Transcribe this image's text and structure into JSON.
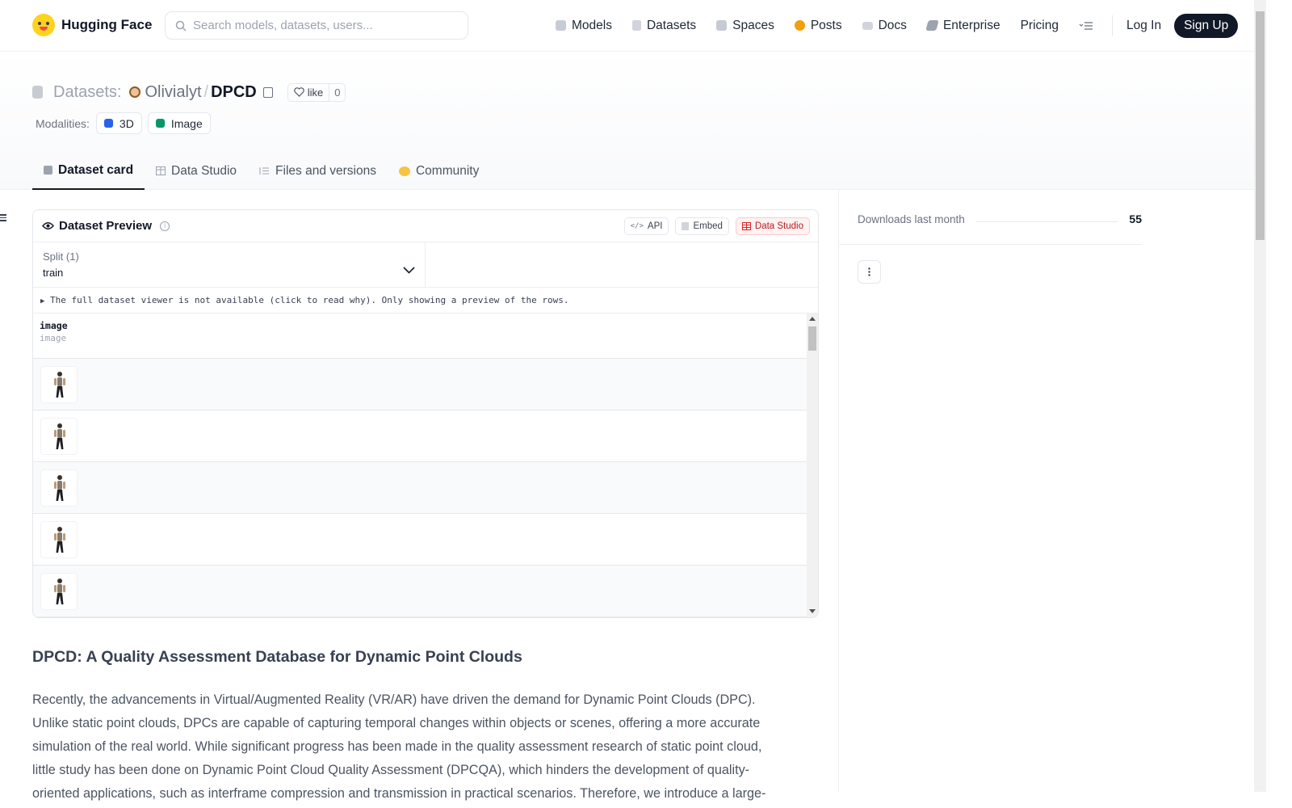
{
  "header": {
    "brand": "Hugging Face",
    "search_placeholder": "Search models, datasets, users...",
    "nav": [
      {
        "label": "Models",
        "icon": "cube-icon",
        "color": "#c7cbd6"
      },
      {
        "label": "Datasets",
        "icon": "database-icon",
        "color": "#d1d5db"
      },
      {
        "label": "Spaces",
        "icon": "grid-icon",
        "color": "#c5cad4"
      },
      {
        "label": "Posts",
        "icon": "chat-bubble-icon",
        "color": "#f59e0b"
      },
      {
        "label": "Docs",
        "icon": "book-icon",
        "color": "#d1d5db"
      },
      {
        "label": "Enterprise",
        "icon": "building-icon",
        "color": "#9ca3af"
      },
      {
        "label": "Pricing",
        "icon": "",
        "color": ""
      }
    ],
    "login": "Log In",
    "signup": "Sign Up"
  },
  "repo": {
    "type_label": "Datasets:",
    "owner": "Olivialyt",
    "separator": "/",
    "name": "DPCD",
    "like_label": "like",
    "like_count": "0",
    "modalities_label": "Modalities:",
    "modalities": [
      {
        "label": "3D",
        "color": "#2563eb"
      },
      {
        "label": "Image",
        "color": "#059669"
      }
    ]
  },
  "tabs": [
    {
      "label": "Dataset card",
      "active": true
    },
    {
      "label": "Data Studio",
      "active": false
    },
    {
      "label": "Files and versions",
      "active": false
    },
    {
      "label": "Community",
      "active": false
    }
  ],
  "preview": {
    "title": "Dataset Preview",
    "buttons": {
      "api": "API",
      "embed": "Embed",
      "studio": "Data Studio"
    },
    "split_label": "Split (1)",
    "split_value": "train",
    "notice": "The full dataset viewer is not available (click to read why). Only showing a preview of the rows.",
    "column_name": "image",
    "column_type": "image",
    "row_count": 5
  },
  "readme": {
    "heading": "DPCD: A Quality Assessment Database for Dynamic Point Clouds",
    "paragraph": "Recently, the advancements in Virtual/Augmented Reality (VR/AR) have driven the demand for Dynamic Point Clouds (DPC). Unlike static point clouds, DPCs are capable of capturing temporal changes within objects or scenes, offering a more accurate simulation of the real world. While significant progress has been made in the quality assessment research of static point cloud, little study has been done on Dynamic Point Cloud Quality Assessment (DPCQA), which hinders the development of quality-oriented applications, such as interframe compression and transmission in practical scenarios. Therefore, we introduce a large-scale DPCQA database"
  },
  "sidebar": {
    "downloads_label": "Downloads last month",
    "downloads_value": "55"
  }
}
